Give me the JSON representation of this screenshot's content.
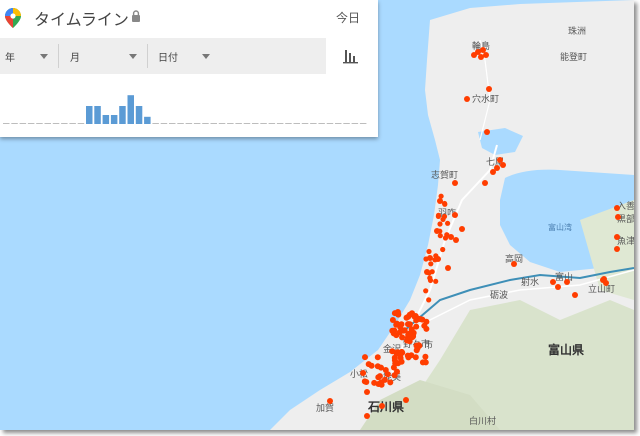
{
  "header": {
    "title": "タイムライン",
    "today_label": "今日"
  },
  "filters": {
    "year_label": "年",
    "month_label": "月",
    "day_label": "日付"
  },
  "icons": {
    "app": "maps-pin-icon",
    "lock": "lock-icon",
    "chart": "bar-chart-icon",
    "caret": "chevron-down-icon"
  },
  "histogram": {
    "values": [
      0,
      0,
      0,
      0,
      0,
      0,
      0,
      0,
      0,
      0,
      1,
      1,
      0.5,
      0.5,
      1,
      1.6,
      1,
      0.4,
      0,
      0,
      0,
      0,
      0,
      0,
      0,
      0,
      0,
      0,
      0,
      0,
      0,
      0,
      0,
      0,
      0,
      0,
      0,
      0,
      0,
      0,
      0,
      0,
      0,
      0
    ],
    "background": [
      0,
      0,
      0,
      0,
      0,
      0,
      0,
      0,
      0,
      0,
      0,
      0,
      0,
      0,
      0,
      1,
      0,
      0,
      0,
      0,
      0,
      0,
      0,
      0,
      0,
      0,
      0,
      0,
      0,
      0,
      0,
      0,
      0,
      0,
      0,
      0,
      0,
      0,
      0,
      0,
      0,
      0,
      0,
      0
    ],
    "bar_color": "#5b9bd5",
    "bg_color": "#d6d6d6"
  },
  "map": {
    "places": [
      "輪島",
      "珠洲",
      "能登町",
      "穴水町",
      "七尾",
      "志賀町",
      "羽咋",
      "高岡",
      "射水",
      "富山",
      "砺波",
      "立山町",
      "入善",
      "黒部",
      "魚津",
      "市",
      "能美",
      "小松",
      "加賀",
      "白川村",
      "金沢",
      "野々市"
    ],
    "prefectures": [
      "富山県",
      "石川県"
    ],
    "sea": "富山湾",
    "colors": {
      "water": "#aadaff",
      "land": "#eeeeee",
      "mountain": "#d9e3cc",
      "rail": "#3e8fb7",
      "road": "#ffffff",
      "marker": "#ff3d00"
    }
  }
}
